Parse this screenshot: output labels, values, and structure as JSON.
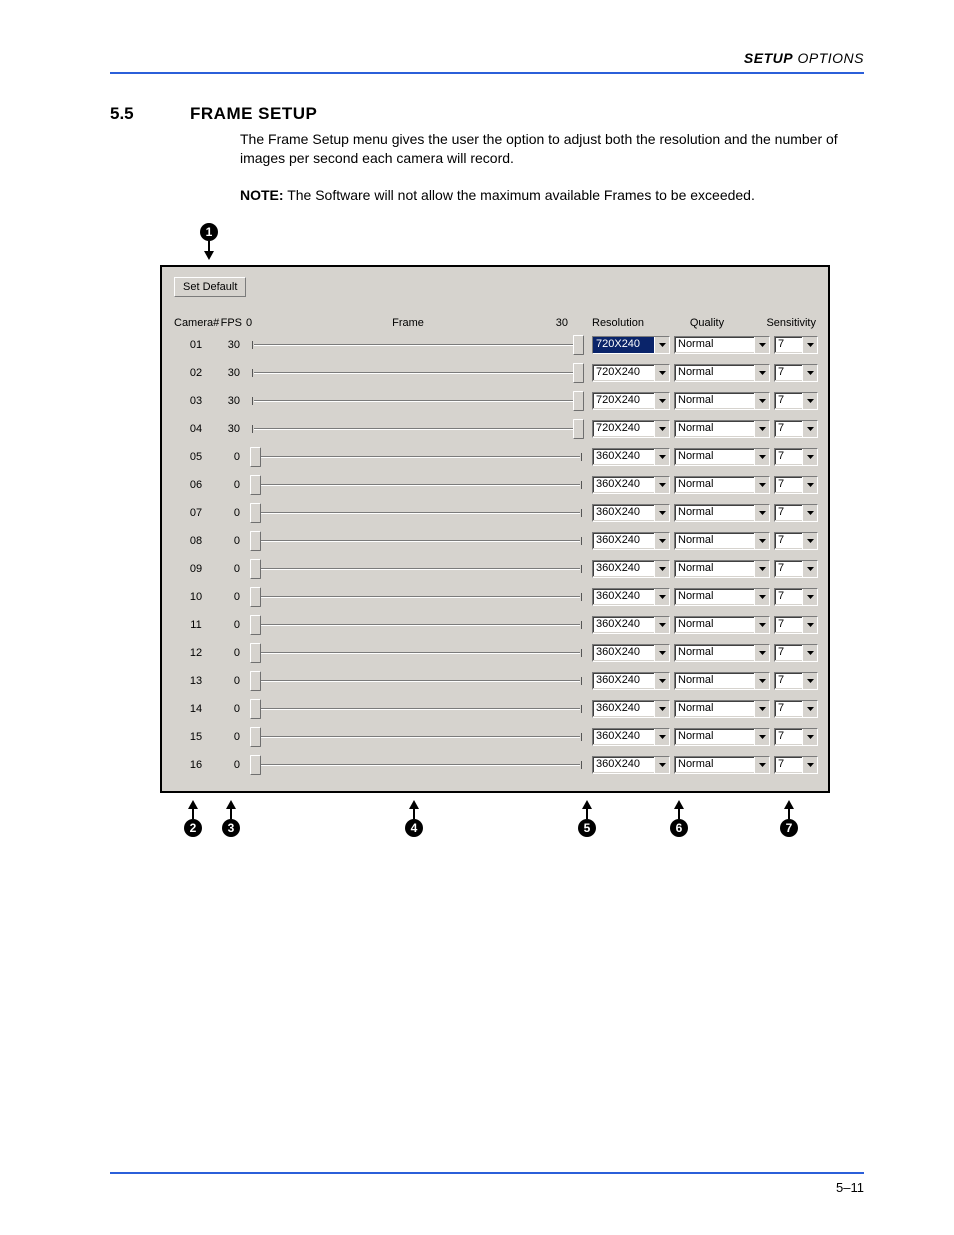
{
  "header": {
    "bold": "SETUP",
    "rest": " OPTIONS"
  },
  "section": {
    "num": "5.5",
    "title": "FRAME SETUP"
  },
  "para": "The Frame Setup menu gives the user the option to adjust both the resolution and the number of images per second each camera will record.",
  "note_label": "NOTE:",
  "note_text": " The Software will not allow the maximum available Frames to be exceeded.",
  "panel": {
    "set_default": "Set Default",
    "hdr": {
      "camera": "Camera#",
      "fps": "FPS",
      "fmin": "0",
      "frame": "Frame",
      "fmax": "30",
      "resolution": "Resolution",
      "quality": "Quality",
      "sensitivity": "Sensitivity"
    },
    "slider_max": 30,
    "rows": [
      {
        "cam": "01",
        "fps": "30",
        "slider": 30,
        "res": "720X240",
        "qual": "Normal",
        "sens": "7",
        "selected": true
      },
      {
        "cam": "02",
        "fps": "30",
        "slider": 30,
        "res": "720X240",
        "qual": "Normal",
        "sens": "7"
      },
      {
        "cam": "03",
        "fps": "30",
        "slider": 30,
        "res": "720X240",
        "qual": "Normal",
        "sens": "7"
      },
      {
        "cam": "04",
        "fps": "30",
        "slider": 30,
        "res": "720X240",
        "qual": "Normal",
        "sens": "7"
      },
      {
        "cam": "05",
        "fps": "0",
        "slider": 0,
        "res": "360X240",
        "qual": "Normal",
        "sens": "7"
      },
      {
        "cam": "06",
        "fps": "0",
        "slider": 0,
        "res": "360X240",
        "qual": "Normal",
        "sens": "7"
      },
      {
        "cam": "07",
        "fps": "0",
        "slider": 0,
        "res": "360X240",
        "qual": "Normal",
        "sens": "7"
      },
      {
        "cam": "08",
        "fps": "0",
        "slider": 0,
        "res": "360X240",
        "qual": "Normal",
        "sens": "7"
      },
      {
        "cam": "09",
        "fps": "0",
        "slider": 0,
        "res": "360X240",
        "qual": "Normal",
        "sens": "7"
      },
      {
        "cam": "10",
        "fps": "0",
        "slider": 0,
        "res": "360X240",
        "qual": "Normal",
        "sens": "7"
      },
      {
        "cam": "11",
        "fps": "0",
        "slider": 0,
        "res": "360X240",
        "qual": "Normal",
        "sens": "7"
      },
      {
        "cam": "12",
        "fps": "0",
        "slider": 0,
        "res": "360X240",
        "qual": "Normal",
        "sens": "7"
      },
      {
        "cam": "13",
        "fps": "0",
        "slider": 0,
        "res": "360X240",
        "qual": "Normal",
        "sens": "7"
      },
      {
        "cam": "14",
        "fps": "0",
        "slider": 0,
        "res": "360X240",
        "qual": "Normal",
        "sens": "7"
      },
      {
        "cam": "15",
        "fps": "0",
        "slider": 0,
        "res": "360X240",
        "qual": "Normal",
        "sens": "7"
      },
      {
        "cam": "16",
        "fps": "0",
        "slider": 0,
        "res": "360X240",
        "qual": "Normal",
        "sens": "7"
      }
    ]
  },
  "callouts": {
    "top": "1",
    "bottom": [
      "2",
      "3",
      "4",
      "5",
      "6",
      "7"
    ],
    "bottom_x": [
      24,
      62,
      245,
      418,
      510,
      620
    ]
  },
  "page_num": "5–11"
}
